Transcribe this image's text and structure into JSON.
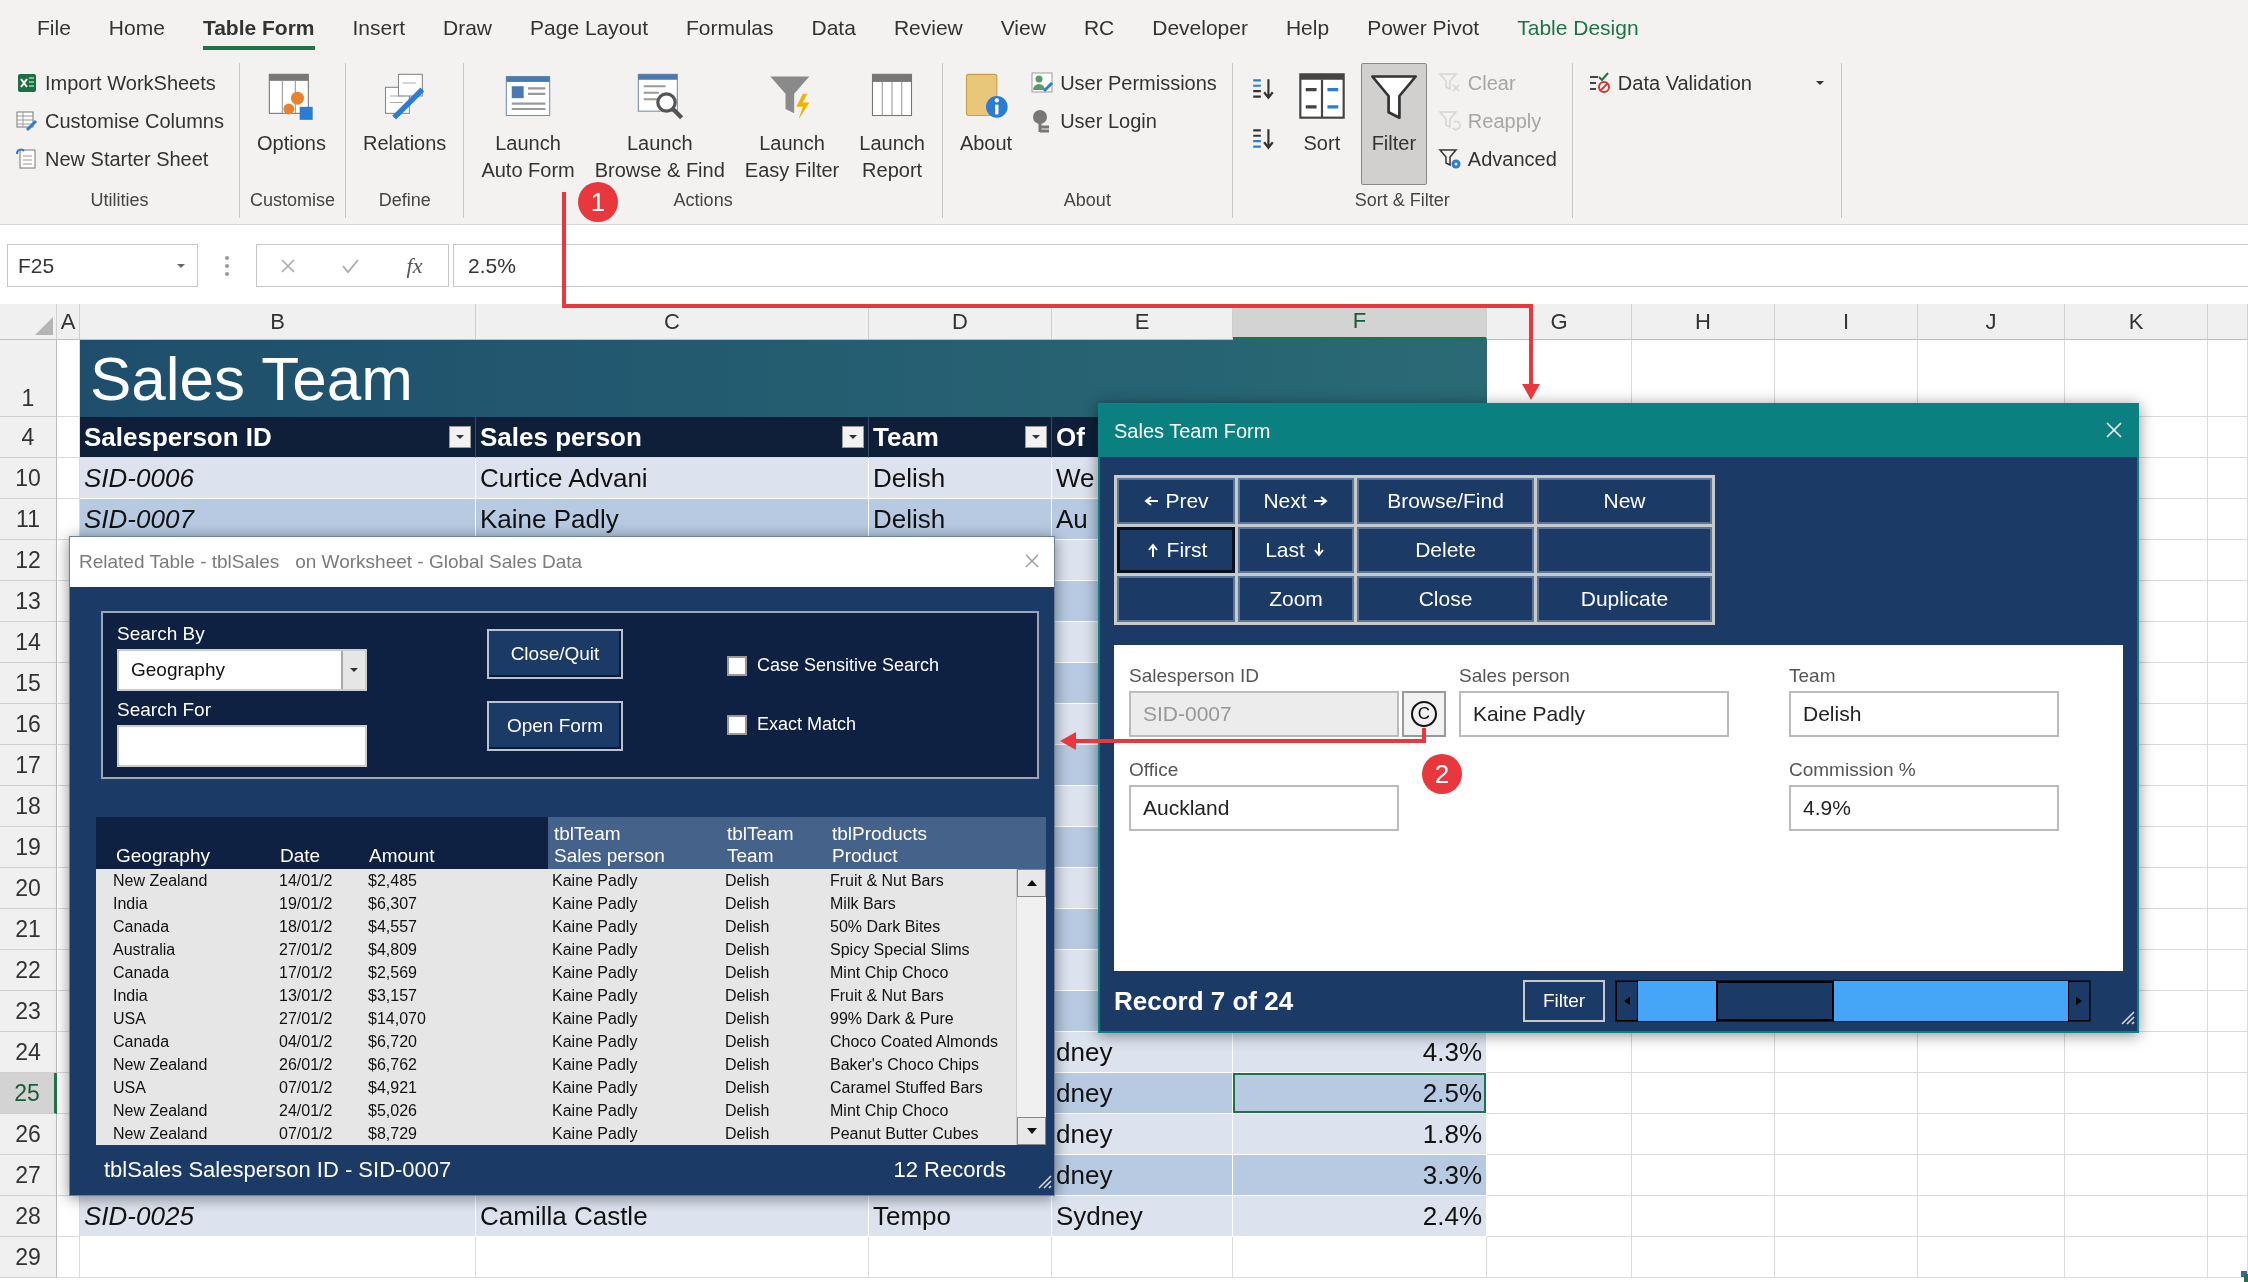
{
  "menu_tabs": [
    {
      "label": "File",
      "selected": false,
      "contextual": false
    },
    {
      "label": "Home",
      "selected": false,
      "contextual": false
    },
    {
      "label": "Table Form",
      "selected": true,
      "contextual": false
    },
    {
      "label": "Insert",
      "selected": false,
      "contextual": false
    },
    {
      "label": "Draw",
      "selected": false,
      "contextual": false
    },
    {
      "label": "Page Layout",
      "selected": false,
      "contextual": false
    },
    {
      "label": "Formulas",
      "selected": false,
      "contextual": false
    },
    {
      "label": "Data",
      "selected": false,
      "contextual": false
    },
    {
      "label": "Review",
      "selected": false,
      "contextual": false
    },
    {
      "label": "View",
      "selected": false,
      "contextual": false
    },
    {
      "label": "RC",
      "selected": false,
      "contextual": false
    },
    {
      "label": "Developer",
      "selected": false,
      "contextual": false
    },
    {
      "label": "Help",
      "selected": false,
      "contextual": false
    },
    {
      "label": "Power Pivot",
      "selected": false,
      "contextual": false
    },
    {
      "label": "Table Design",
      "selected": false,
      "contextual": true
    }
  ],
  "ribbon": {
    "groups": [
      {
        "label": "Utilities",
        "buttons": [
          {
            "label": "Import WorkSheets",
            "kind": "small",
            "disabled": false,
            "pressed": false
          },
          {
            "label": "Customise Columns",
            "kind": "small",
            "disabled": false,
            "pressed": false
          },
          {
            "label": "New Starter Sheet",
            "kind": "small",
            "disabled": false,
            "pressed": false
          }
        ]
      },
      {
        "label": "Customise",
        "buttons": [
          {
            "label": "Options",
            "kind": "large",
            "disabled": false,
            "pressed": false
          }
        ]
      },
      {
        "label": "Define",
        "buttons": [
          {
            "label": "Relations",
            "kind": "large",
            "disabled": false,
            "pressed": false
          }
        ]
      },
      {
        "label": "Actions",
        "buttons": [
          {
            "label": "Launch\nAuto Form",
            "kind": "large",
            "disabled": false,
            "pressed": false
          },
          {
            "label": "Launch\nBrowse & Find",
            "kind": "large",
            "disabled": false,
            "pressed": false
          },
          {
            "label": "Launch\nEasy Filter",
            "kind": "large",
            "disabled": false,
            "pressed": false
          },
          {
            "label": "Launch\nReport",
            "kind": "large",
            "disabled": false,
            "pressed": false
          }
        ]
      },
      {
        "label": "About",
        "buttons": [
          {
            "label": "About",
            "kind": "large",
            "disabled": false,
            "pressed": false
          },
          {
            "label": "User Permissions",
            "kind": "small",
            "disabled": false,
            "pressed": false
          },
          {
            "label": "User Login",
            "kind": "small",
            "disabled": false,
            "pressed": false
          }
        ]
      },
      {
        "label": "Sort & Filter",
        "buttons": [
          {
            "kind": "icon",
            "disabled": false,
            "pressed": false
          },
          {
            "kind": "icon",
            "disabled": false,
            "pressed": false
          },
          {
            "label": "Sort",
            "kind": "large",
            "disabled": false,
            "pressed": false
          },
          {
            "label": "Filter",
            "kind": "large",
            "disabled": false,
            "pressed": true
          },
          {
            "label": "Clear",
            "kind": "small",
            "disabled": true,
            "pressed": false
          },
          {
            "label": "Reapply",
            "kind": "small",
            "disabled": true,
            "pressed": false
          },
          {
            "label": "Advanced",
            "kind": "small",
            "disabled": false,
            "pressed": false
          }
        ]
      },
      {
        "buttons": [
          {
            "label": "Data Validation",
            "kind": "dropdown",
            "disabled": false,
            "pressed": false
          }
        ]
      }
    ]
  },
  "sheet": {
    "name_box": "F25",
    "function_label": "fx",
    "formula": "2.5%",
    "columns": [
      {
        "label": "A",
        "selected": false
      },
      {
        "label": "B",
        "selected": false
      },
      {
        "label": "C",
        "selected": false
      },
      {
        "label": "D",
        "selected": false
      },
      {
        "label": "E",
        "selected": false
      },
      {
        "label": "F",
        "selected": true
      },
      {
        "label": "G",
        "selected": false
      },
      {
        "label": "H",
        "selected": false
      },
      {
        "label": "I",
        "selected": false
      },
      {
        "label": "J",
        "selected": false
      },
      {
        "label": "K",
        "selected": false
      }
    ],
    "title_row": {
      "number": "1",
      "title": "Sales Team"
    },
    "header_row": {
      "number": "4",
      "headers": [
        {
          "label": "Salesperson ID",
          "filter_button": true
        },
        {
          "label": "Sales person",
          "filter_button": true
        },
        {
          "label": "Team",
          "filter_button": true
        },
        {
          "label": "Of"
        }
      ]
    },
    "rows": [
      {
        "number": "10",
        "selected": false,
        "in_table": true,
        "cells": {
          "B": "SID-0006",
          "C": "Curtice Advani",
          "D": "Delish",
          "E": "We"
        }
      },
      {
        "number": "11",
        "selected": false,
        "in_table": true,
        "cells": {
          "B": "SID-0007",
          "C": "Kaine Padly",
          "D": "Delish",
          "E": "Au"
        }
      },
      {
        "number": "12",
        "selected": false,
        "in_table": true
      },
      {
        "number": "13",
        "selected": false,
        "in_table": true
      },
      {
        "number": "14",
        "selected": false,
        "in_table": true
      },
      {
        "number": "15",
        "selected": false,
        "in_table": true
      },
      {
        "number": "16",
        "selected": false,
        "in_table": true
      },
      {
        "number": "17",
        "selected": false,
        "in_table": true
      },
      {
        "number": "18",
        "selected": false,
        "in_table": true
      },
      {
        "number": "19",
        "selected": false,
        "in_table": true
      },
      {
        "number": "20",
        "selected": false,
        "in_table": true
      },
      {
        "number": "21",
        "selected": false,
        "in_table": true
      },
      {
        "number": "22",
        "selected": false,
        "in_table": true
      },
      {
        "number": "23",
        "selected": false,
        "in_table": true
      },
      {
        "number": "24",
        "selected": false,
        "in_table": true,
        "cells": {
          "E": "dney",
          "F": "4.3%"
        }
      },
      {
        "number": "25",
        "selected": true,
        "in_table": true,
        "cells": {
          "E": "dney",
          "F": "2.5%"
        }
      },
      {
        "number": "26",
        "selected": false,
        "in_table": true,
        "cells": {
          "E": "dney",
          "F": "1.8%"
        }
      },
      {
        "number": "27",
        "selected": false,
        "in_table": true,
        "cells": {
          "E": "dney",
          "F": "3.3%"
        }
      },
      {
        "number": "28",
        "selected": false,
        "in_table": true,
        "cells": {
          "B": "SID-0025",
          "C": "Camilla Castle",
          "D": "Tempo",
          "E": "Sydney",
          "F": "2.4%"
        }
      },
      {
        "number": "29",
        "selected": false,
        "in_table": false
      }
    ]
  },
  "related_dialog": {
    "title": "Related Table - tblSales   on Worksheet - Global Sales Data",
    "search_by_label": "Search By",
    "search_by_value": "Geography",
    "search_for_label": "Search For",
    "buttons": [
      "Close/Quit",
      "Open Form"
    ],
    "options": [
      {
        "label": "Case Sensitive Search",
        "checked": false
      },
      {
        "label": "Exact Match",
        "checked": false
      }
    ],
    "list": {
      "columns": [
        {
          "label": "Geography",
          "kind": "main"
        },
        {
          "label": "Date",
          "kind": "main"
        },
        {
          "label": "Amount",
          "kind": "main"
        },
        {
          "label": "tblTeam\nSales person",
          "kind": "related"
        },
        {
          "label": "tblTeam\nTeam",
          "kind": "related"
        },
        {
          "label": "tblProducts\nProduct",
          "kind": "related"
        }
      ],
      "rows": [
        [
          "New Zealand",
          "14/01/2",
          "$2,485",
          "Kaine Padly",
          "Delish",
          "Fruit & Nut Bars"
        ],
        [
          "India",
          "19/01/2",
          "$6,307",
          "Kaine Padly",
          "Delish",
          "Milk Bars"
        ],
        [
          "Canada",
          "18/01/2",
          "$4,557",
          "Kaine Padly",
          "Delish",
          "50% Dark Bites"
        ],
        [
          "Australia",
          "27/01/2",
          "$4,809",
          "Kaine Padly",
          "Delish",
          "Spicy Special Slims"
        ],
        [
          "Canada",
          "17/01/2",
          "$2,569",
          "Kaine Padly",
          "Delish",
          "Mint Chip Choco"
        ],
        [
          "India",
          "13/01/2",
          "$3,157",
          "Kaine Padly",
          "Delish",
          "Fruit & Nut Bars"
        ],
        [
          "USA",
          "27/01/2",
          "$14,070",
          "Kaine Padly",
          "Delish",
          "99% Dark & Pure"
        ],
        [
          "Canada",
          "04/01/2",
          "$6,720",
          "Kaine Padly",
          "Delish",
          "Choco Coated Almonds"
        ],
        [
          "New Zealand",
          "26/01/2",
          "$6,762",
          "Kaine Padly",
          "Delish",
          "Baker's Choco Chips"
        ],
        [
          "USA",
          "07/01/2",
          "$4,921",
          "Kaine Padly",
          "Delish",
          "Caramel Stuffed Bars"
        ],
        [
          "New Zealand",
          "24/01/2",
          "$5,026",
          "Kaine Padly",
          "Delish",
          "Mint Chip Choco"
        ],
        [
          "New Zealand",
          "07/01/2",
          "$8,729",
          "Kaine Padly",
          "Delish",
          "Peanut Butter Cubes"
        ]
      ]
    },
    "footer_left": "tblSales Salesperson ID - SID-0007",
    "footer_right": "12 Records"
  },
  "team_form": {
    "title": "Sales Team Form",
    "nav_buttons": [
      {
        "kind": "command",
        "label": "Prev",
        "focused": false
      },
      {
        "kind": "command",
        "label": "Next",
        "focused": false
      },
      {
        "kind": "command",
        "label": "Browse/Find",
        "focused": false
      },
      {
        "kind": "command",
        "label": "New",
        "focused": false
      },
      {
        "kind": "command",
        "label": "First",
        "focused": true
      },
      {
        "kind": "command",
        "label": "Last",
        "focused": false
      },
      {
        "kind": "command",
        "label": "Delete",
        "focused": false
      },
      {
        "kind": "blank",
        "focused": false
      },
      {
        "kind": "blank",
        "focused": false
      },
      {
        "kind": "command",
        "label": "Zoom",
        "focused": false
      },
      {
        "kind": "command",
        "label": "Close",
        "focused": false
      },
      {
        "kind": "command",
        "label": "Duplicate",
        "focused": false
      }
    ],
    "fields": [
      {
        "label": "Salesperson ID",
        "value": "SID-0007",
        "disabled": true,
        "button": "C"
      },
      {
        "label": "Sales person",
        "value": "Kaine Padly",
        "disabled": false
      },
      {
        "label": "Team",
        "value": "Delish",
        "disabled": false
      },
      {
        "label": "Office",
        "value": "Auckland",
        "disabled": false
      },
      {
        "label": "Commission %",
        "value": "4.9%",
        "disabled": false
      }
    ],
    "record_label": "Record 7 of 24",
    "filter_button": "Filter"
  },
  "callouts": [
    {
      "number": "1"
    },
    {
      "number": "2"
    }
  ]
}
